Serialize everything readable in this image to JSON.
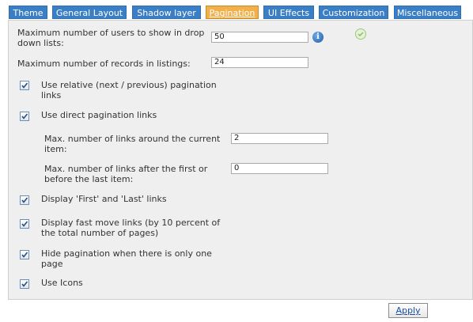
{
  "tabs": [
    {
      "label": "Theme",
      "active": false
    },
    {
      "label": "General Layout",
      "active": false
    },
    {
      "label": "Shadow layer",
      "active": false
    },
    {
      "label": "Pagination",
      "active": true
    },
    {
      "label": "UI Effects",
      "active": false
    },
    {
      "label": "Customization",
      "active": false
    },
    {
      "label": "Miscellaneous",
      "active": false
    }
  ],
  "fields": {
    "max_users_label_1": "Maximum number of users to show in drop",
    "max_users_label_2": "down lists:",
    "max_users_value": "50",
    "max_records_label": "Maximum number of records in listings:",
    "max_records_value": "24",
    "links_around_label_1": "Max. number of links around the current",
    "links_around_label_2": "item:",
    "links_around_value": "2",
    "links_after_label_1": "Max. number of links after the first or",
    "links_after_label_2": "before the last item:",
    "links_after_value": "0"
  },
  "checkboxes": {
    "relative_1": "Use relative (next / previous) pagination",
    "relative_2": "links",
    "direct": "Use direct pagination links",
    "first_last": "Display 'First' and 'Last' links",
    "fast_move_1": "Display fast move links (by 10 percent of",
    "fast_move_2": "the total number of pages)",
    "hide_1": "Hide pagination when there is only one",
    "hide_2": "page",
    "icons": "Use Icons"
  },
  "icons": {
    "info": "info-icon",
    "ok": "check-circle-icon",
    "info_glyph": "i"
  },
  "buttons": {
    "apply": "Apply"
  },
  "colors": {
    "tab": "#3a7fc6",
    "tab_active": "#f2b04a",
    "panel": "#efefef"
  }
}
